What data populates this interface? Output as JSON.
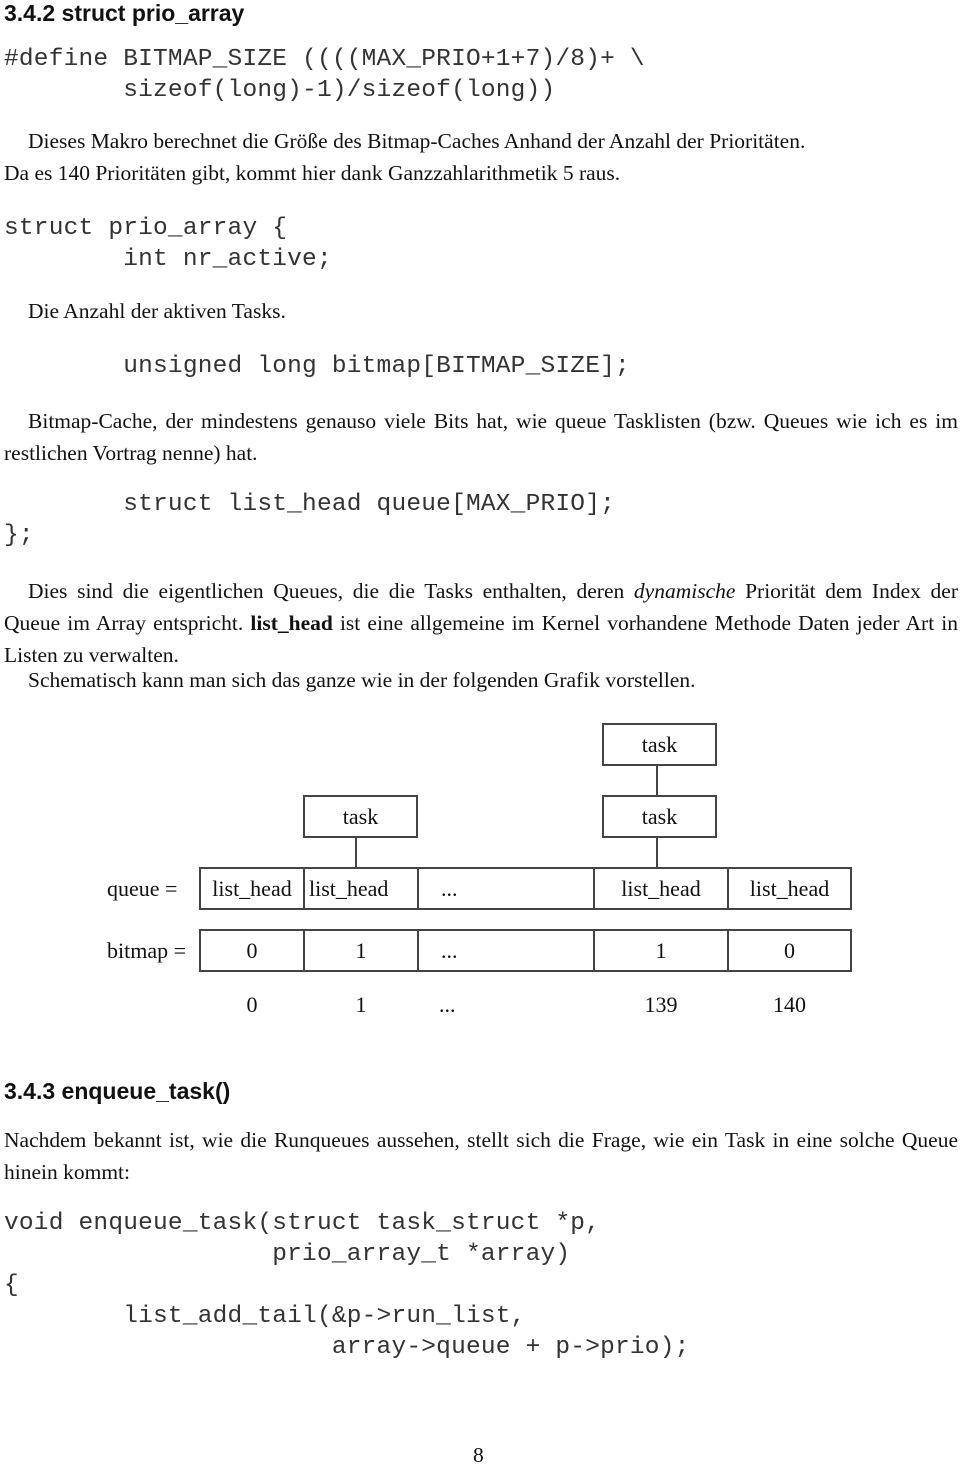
{
  "section_342": {
    "heading": "3.4.2 struct prio_array",
    "define_line1": "#define BITMAP_SIZE ((((MAX_PRIO+1+7)/8)+ \\",
    "define_line2": "        sizeof(long)-1)/sizeof(long))",
    "macro_desc_line1": "Dieses Makro berechnet die Größe des Bitmap-Caches Anhand der Anzahl der Prioritäten.",
    "macro_desc_line2": "Da es 140 Prioritäten gibt, kommt hier dank Ganzzahlarithmetik 5 raus.",
    "struct_open": "struct prio_array {",
    "field_nr_active": "        int nr_active;",
    "nr_active_desc": "Die Anzahl der aktiven Tasks.",
    "field_bitmap": "        unsigned long bitmap[BITMAP_SIZE];",
    "bitmap_desc": "Bitmap-Cache, der mindestens genauso viele Bits hat, wie queue Tasklisten (bzw. Queues wie ich es im restlichen Vortrag nenne) hat.",
    "field_queue": "        struct list_head queue[MAX_PRIO];",
    "struct_close": "};",
    "queue_desc_part1": "Dies sind die eigentlichen Queues, die die Tasks enthalten, deren ",
    "queue_desc_italic": "dynamische",
    "queue_desc_part2": " Priorität dem Index der Queue im Array entspricht. ",
    "queue_desc_bold": "list_head",
    "queue_desc_part3": " ist eine allgemeine im Kernel vorhandene Methode Daten jeder Art in Listen zu verwalten.",
    "schema_intro": "Schematisch kann man sich das ganze wie in der folgenden Grafik vorstellen."
  },
  "diagram": {
    "task_label": "task",
    "queue_label": "queue =",
    "bitmap_label": "bitmap =",
    "queue_cells": [
      "list_head",
      "list_head",
      "...",
      "list_head",
      "list_head"
    ],
    "bitmap_cells": [
      "0",
      "1",
      "...",
      "1",
      "0"
    ],
    "index_labels": [
      "0",
      "1",
      "...",
      "139",
      "140"
    ],
    "tasks_per_column": [
      0,
      1,
      0,
      2,
      0
    ]
  },
  "section_343": {
    "heading": "3.4.3 enqueue_task()",
    "intro": "Nachdem bekannt ist, wie die Runqueues aussehen, stellt sich die Frage, wie ein Task in eine solche Queue hinein kommt:",
    "code_lines": [
      "void enqueue_task(struct task_struct *p,",
      "                  prio_array_t *array)",
      "{",
      "        list_add_tail(&p->run_list,",
      "                      array->queue + p->prio);"
    ]
  },
  "page_number": "8"
}
